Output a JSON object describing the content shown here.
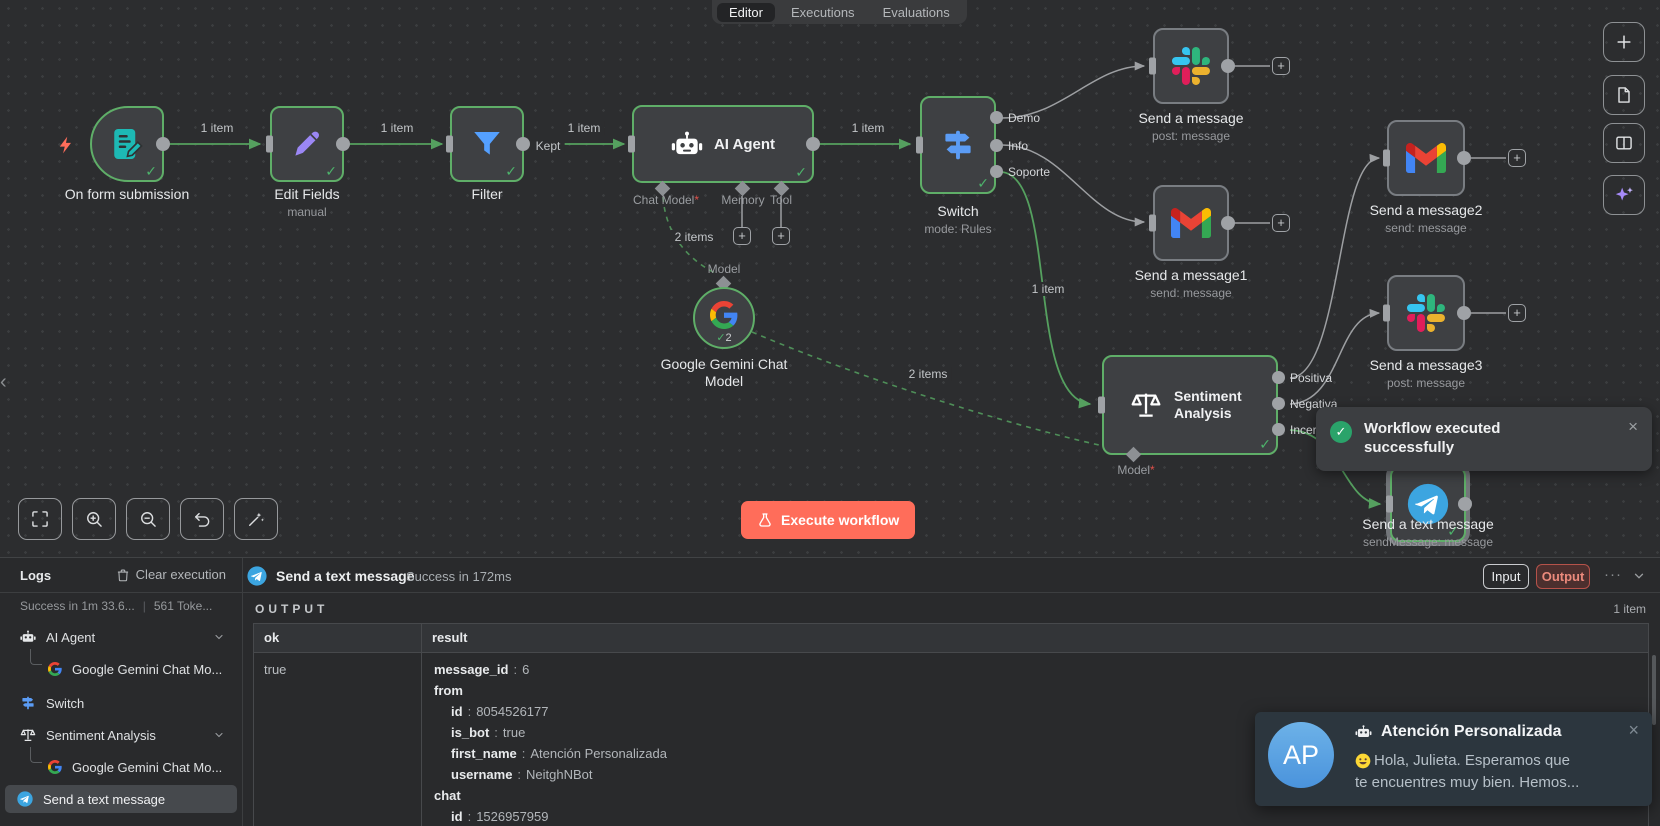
{
  "tabs": {
    "items": [
      {
        "label": "Editor"
      },
      {
        "label": "Executions"
      },
      {
        "label": "Evaluations"
      }
    ]
  },
  "canvas": {
    "edge_labels": {
      "e1": "1 item",
      "e2": "1 item",
      "e3": "1 item",
      "kept": "Kept",
      "e4": "1 item",
      "e5": "1 item",
      "m1": "2 items",
      "m2": "2 items"
    },
    "nodes": {
      "form": {
        "title": "On form submission"
      },
      "edit": {
        "title": "Edit Fields",
        "subtitle": "manual"
      },
      "filter": {
        "title": "Filter"
      },
      "agent": {
        "title": "AI Agent",
        "ports": [
          {
            "label": "Chat Model",
            "required": "*"
          },
          {
            "label": "Memory"
          },
          {
            "label": "Tool"
          }
        ],
        "plus": "+"
      },
      "gemini": {
        "title": "Google Gemini Chat Model",
        "runs": "2",
        "port": "Model"
      },
      "switch": {
        "title": "Switch",
        "subtitle": "mode: Rules",
        "outputs": [
          "Demo",
          "Info",
          "Soporte"
        ]
      },
      "slack1": {
        "title": "Send a message",
        "subtitle": "post: message"
      },
      "gmail1": {
        "title": "Send a message1",
        "subtitle": "send: message"
      },
      "gmail2": {
        "title": "Send a message2",
        "subtitle": "send: message"
      },
      "slack2": {
        "title": "Send a message3",
        "subtitle": "post: message"
      },
      "sentiment": {
        "title": "Sentiment Analysis",
        "outputs": [
          "Positiva",
          "Negativa",
          "Incer"
        ],
        "port": "Model",
        "required": "*"
      },
      "telegram": {
        "title": "Send a text message",
        "subtitle": "sendMessage: message"
      }
    },
    "controls": {
      "execute": "Execute workflow",
      "plus": "+"
    }
  },
  "toast": {
    "line1": "Workflow executed",
    "line2": "successfully",
    "close": "×"
  },
  "logs": {
    "title": "Logs",
    "clear": "Clear execution",
    "summary_time": "Success in 1m 33.6...",
    "sep": "|",
    "summary_tokens": "561 Toke...",
    "tree": [
      {
        "label": "AI Agent"
      },
      {
        "label": "Google Gemini Chat Mo..."
      },
      {
        "label": "Switch"
      },
      {
        "label": "Sentiment Analysis"
      },
      {
        "label": "Google Gemini Chat Mo..."
      },
      {
        "label": "Send a text message"
      }
    ]
  },
  "run_panel": {
    "node": "Send a text message",
    "status": "Success in 172ms",
    "input": "Input",
    "output": "Output",
    "section": "OUTPUT",
    "count": "1 item",
    "sep": ":",
    "columns": {
      "ok": "ok",
      "result": "result"
    },
    "ok_value": "true",
    "result_rows": [
      {
        "key": "message_id",
        "value": "6"
      },
      {
        "key": "from",
        "value": ""
      },
      {
        "key": "id",
        "value": "8054526177"
      },
      {
        "key": "is_bot",
        "value": "true"
      },
      {
        "key": "first_name",
        "value": "Atención Personalizada"
      },
      {
        "key": "username",
        "value": "NeitghNBot"
      },
      {
        "key": "chat",
        "value": ""
      },
      {
        "key": "id",
        "value": "1526957959"
      }
    ]
  },
  "popup": {
    "avatar": "AP",
    "title": "Atención Personalizada",
    "line1": "Hola,  Julieta. Esperamos que",
    "line2": "te encuentres muy bien.  Hemos...",
    "close": "×"
  },
  "colors": {
    "accent": "#ff6d5a",
    "success_border": "#5fae68",
    "edge_green": "#55a05f",
    "edge_gray": "#9d9fa2",
    "output_btn_border": "#b5524a"
  }
}
